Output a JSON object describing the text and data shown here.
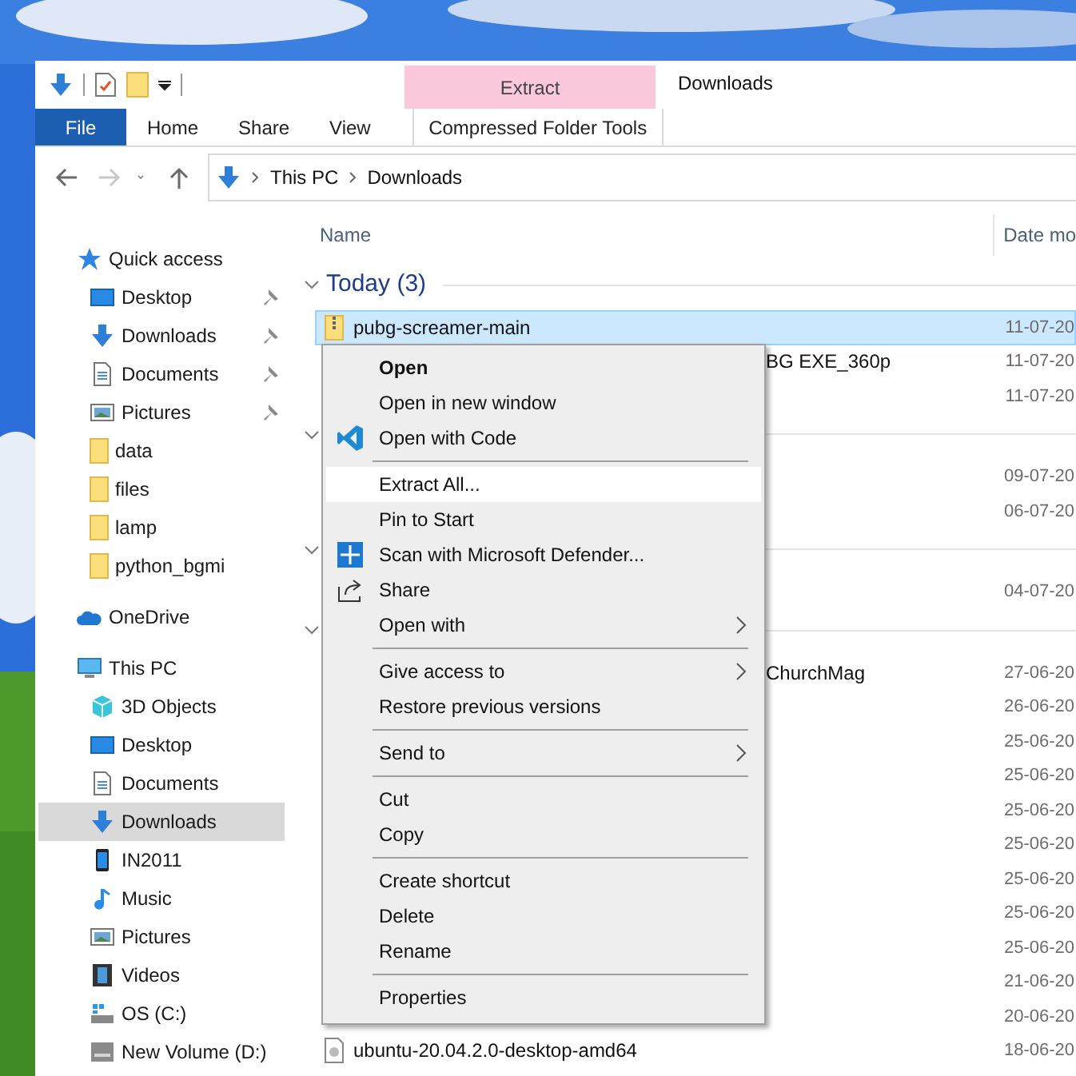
{
  "window": {
    "title": "Downloads",
    "context_tab": "Extract"
  },
  "ribbon_tabs": [
    {
      "label": "File",
      "kind": "file",
      "selected": false
    },
    {
      "label": "Home",
      "kind": "tab",
      "selected": false
    },
    {
      "label": "Share",
      "kind": "tab",
      "selected": false
    },
    {
      "label": "View",
      "kind": "tab",
      "selected": false
    },
    {
      "label": "Compressed Folder Tools",
      "kind": "contextual",
      "selected": false
    }
  ],
  "navigation": [
    {
      "kind": "back",
      "disabled": false
    },
    {
      "kind": "forward",
      "disabled": true
    },
    {
      "kind": "recent",
      "disabled": false
    },
    {
      "kind": "up",
      "disabled": false
    }
  ],
  "address": {
    "path": [
      "This PC",
      "Downloads"
    ]
  },
  "sidebar": {
    "items": [
      {
        "label": "Quick access",
        "kind": "quick",
        "selected": false,
        "children": [
          {
            "label": "Desktop",
            "kind": "desktop",
            "pinned": true,
            "selected": false
          },
          {
            "label": "Downloads",
            "kind": "downloads",
            "pinned": true,
            "selected": false
          },
          {
            "label": "Documents",
            "kind": "documents",
            "pinned": true,
            "selected": false
          },
          {
            "label": "Pictures",
            "kind": "pictures",
            "pinned": true,
            "selected": false
          },
          {
            "label": "data",
            "kind": "folder",
            "pinned": false,
            "selected": false
          },
          {
            "label": "files",
            "kind": "folder",
            "pinned": false,
            "selected": false
          },
          {
            "label": "lamp",
            "kind": "folder",
            "pinned": false,
            "selected": false
          },
          {
            "label": "python_bgmi",
            "kind": "folder",
            "pinned": false,
            "selected": false
          }
        ]
      },
      {
        "label": "OneDrive",
        "kind": "cloud",
        "selected": false
      },
      {
        "label": "This PC",
        "kind": "pc",
        "selected": false,
        "children": [
          {
            "label": "3D Objects",
            "kind": "cube",
            "selected": false
          },
          {
            "label": "Desktop",
            "kind": "desktop",
            "selected": false
          },
          {
            "label": "Documents",
            "kind": "documents",
            "selected": false
          },
          {
            "label": "Downloads",
            "kind": "downloads",
            "selected": true
          },
          {
            "label": "IN2011",
            "kind": "phone",
            "selected": false
          },
          {
            "label": "Music",
            "kind": "music",
            "selected": false
          },
          {
            "label": "Pictures",
            "kind": "pictures",
            "selected": false
          },
          {
            "label": "Videos",
            "kind": "videos",
            "selected": false
          },
          {
            "label": "OS (C:)",
            "kind": "osdrive",
            "selected": false
          },
          {
            "label": "New Volume (D:)",
            "kind": "drive",
            "selected": false
          }
        ]
      }
    ]
  },
  "file_list": {
    "columns": [
      "Name",
      "Date mo"
    ],
    "groups": [
      {
        "title": "Today (3)",
        "expanded": true,
        "rows": [
          {
            "kind": "zip",
            "name": "pubg-screamer-main",
            "date": "11-07-20",
            "selected": true
          },
          {
            "kind": "covered",
            "name": "BG EXE_360p",
            "date": "11-07-20",
            "selected": false
          },
          {
            "kind": "covered",
            "date": "11-07-20",
            "selected": false
          }
        ]
      },
      {
        "expanded": true,
        "rows": [
          {
            "kind": "covered",
            "date": "09-07-20",
            "selected": false
          },
          {
            "kind": "covered",
            "date": "06-07-20",
            "selected": false
          }
        ]
      },
      {
        "expanded": true,
        "rows": [
          {
            "kind": "covered",
            "date": "04-07-20",
            "selected": false
          }
        ]
      },
      {
        "expanded": true,
        "rows": [
          {
            "kind": "covered",
            "name": "ChurchMag",
            "date": "27-06-20",
            "selected": false
          },
          {
            "kind": "covered",
            "date": "26-06-20",
            "selected": false
          },
          {
            "kind": "covered",
            "date": "25-06-20",
            "selected": false
          },
          {
            "kind": "covered",
            "date": "25-06-20",
            "selected": false
          },
          {
            "kind": "covered",
            "date": "25-06-20",
            "selected": false
          },
          {
            "kind": "covered",
            "date": "25-06-20",
            "selected": false
          },
          {
            "kind": "covered",
            "date": "25-06-20",
            "selected": false
          },
          {
            "kind": "covered",
            "date": "25-06-20",
            "selected": false
          },
          {
            "kind": "covered",
            "date": "25-06-20",
            "selected": false
          },
          {
            "kind": "covered",
            "date": "21-06-20",
            "selected": false
          },
          {
            "kind": "covered",
            "date": "20-06-20",
            "selected": false
          },
          {
            "kind": "disc",
            "name": "ubuntu-20.04.2.0-desktop-amd64",
            "date": "18-06-20",
            "selected": false
          }
        ]
      }
    ]
  },
  "context_menu": {
    "items": [
      {
        "kind": "plain",
        "label": "Open",
        "bold": true,
        "selected": false
      },
      {
        "kind": "plain",
        "label": "Open in new window",
        "bold": false,
        "selected": false
      },
      {
        "kind": "code",
        "label": "Open with Code",
        "bold": false,
        "selected": false
      },
      {
        "kind": "separator"
      },
      {
        "kind": "plain",
        "label": "Extract All...",
        "bold": false,
        "selected": true
      },
      {
        "kind": "plain",
        "label": "Pin to Start",
        "bold": false,
        "selected": false
      },
      {
        "kind": "shield",
        "label": "Scan with Microsoft Defender...",
        "bold": false,
        "selected": false
      },
      {
        "kind": "share",
        "label": "Share",
        "bold": false,
        "selected": false
      },
      {
        "kind": "submenu",
        "label": "Open with",
        "bold": false,
        "selected": false
      },
      {
        "kind": "separator"
      },
      {
        "kind": "submenu",
        "label": "Give access to",
        "bold": false,
        "selected": false
      },
      {
        "kind": "plain",
        "label": "Restore previous versions",
        "bold": false,
        "selected": false
      },
      {
        "kind": "separator"
      },
      {
        "kind": "submenu",
        "label": "Send to",
        "bold": false,
        "selected": false
      },
      {
        "kind": "separator"
      },
      {
        "kind": "plain",
        "label": "Cut",
        "bold": false,
        "selected": false
      },
      {
        "kind": "plain",
        "label": "Copy",
        "bold": false,
        "selected": false
      },
      {
        "kind": "separator"
      },
      {
        "kind": "plain",
        "label": "Create shortcut",
        "bold": false,
        "selected": false
      },
      {
        "kind": "plain",
        "label": "Delete",
        "bold": false,
        "selected": false
      },
      {
        "kind": "plain",
        "label": "Rename",
        "bold": false,
        "selected": false
      },
      {
        "kind": "separator"
      },
      {
        "kind": "plain",
        "label": "Properties",
        "bold": false,
        "selected": false
      }
    ]
  }
}
